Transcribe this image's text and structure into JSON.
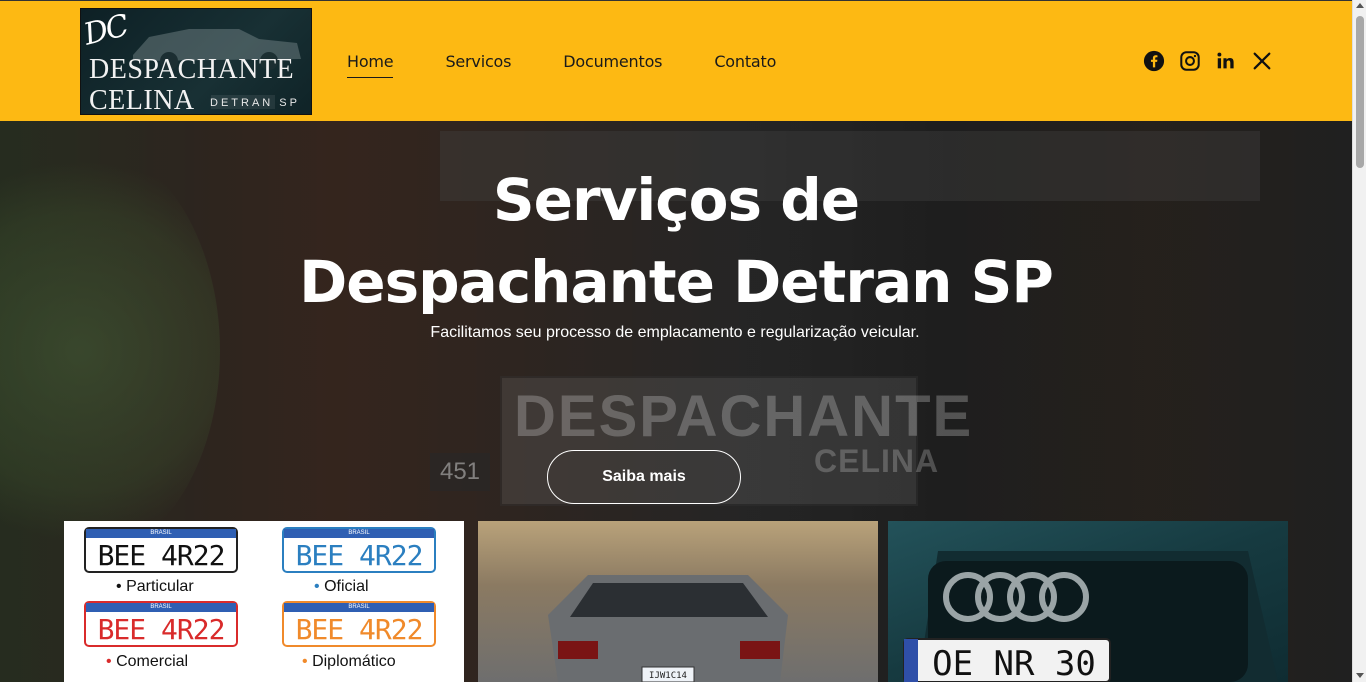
{
  "header": {
    "logo": {
      "monogram": "DC",
      "line1": "DESPACHANTE",
      "line2": "CELINA",
      "tagline": "DETRAN SP"
    },
    "nav": [
      {
        "label": "Home",
        "active": true
      },
      {
        "label": "Servicos",
        "active": false
      },
      {
        "label": "Documentos",
        "active": false
      },
      {
        "label": "Contato",
        "active": false
      }
    ],
    "social_icons": [
      "facebook-icon",
      "instagram-icon",
      "linkedin-icon",
      "x-icon"
    ],
    "background_color": "#fdb913"
  },
  "hero": {
    "title_line1": "Serviços de",
    "title_line2": "Despachante Detran SP",
    "subtitle": "Facilitamos seu processo de emplacamento e regularização veicular.",
    "cta_label": "Saiba mais",
    "bg_sign_text": "DESPACHANTE",
    "bg_sign_text2": "CELINA",
    "bg_number": "451"
  },
  "cards": {
    "plates": [
      {
        "text": "BEE 4R22",
        "country": "BRASIL",
        "label": "Particular",
        "color": "#111111",
        "bullet_color": "#111111"
      },
      {
        "text": "BEE 4R22",
        "country": "BRASIL",
        "label": "Oficial",
        "color": "#2b7fc0",
        "bullet_color": "#2b7fc0"
      },
      {
        "text": "BEE 4R22",
        "country": "BRASIL",
        "label": "Comercial",
        "color": "#d92b2b",
        "bullet_color": "#d92b2b"
      },
      {
        "text": "BEE 4R22",
        "country": "BRASIL",
        "label": "Diplomático",
        "color": "#f08a2b",
        "bullet_color": "#f08a2b"
      }
    ],
    "car_plate": "IJW1C14",
    "audi_plate": "OE NR 30"
  }
}
